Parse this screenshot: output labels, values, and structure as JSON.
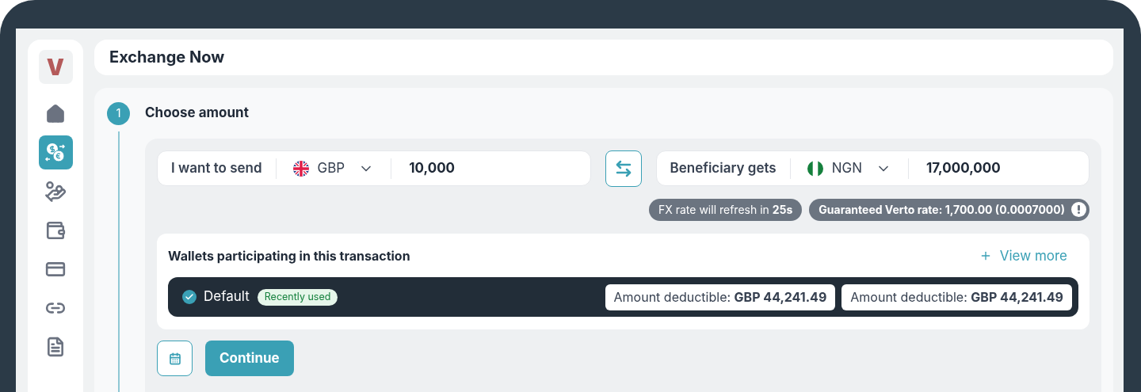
{
  "logo": {
    "letter": "V"
  },
  "sidebar": {
    "items": [
      {
        "selected": false
      },
      {
        "selected": true
      },
      {
        "selected": false
      },
      {
        "selected": false
      },
      {
        "selected": false
      },
      {
        "selected": false
      },
      {
        "selected": false
      }
    ]
  },
  "header": {
    "title": "Exchange Now"
  },
  "step": {
    "number": "1",
    "title": "Choose amount"
  },
  "send": {
    "label": "I want to send",
    "currency": "GBP",
    "amount": "10,000"
  },
  "receive": {
    "label": "Beneficiary gets",
    "currency": "NGN",
    "amount": "17,000,000"
  },
  "refresh_note": "FX rate will refresh in **25s**",
  "rate_note": "Guaranteed Verto rate: 1,700.00 (0.0007000)",
  "wallets": {
    "title": "Wallets participating in this transaction",
    "view_more": "View more",
    "items": [
      {
        "name": "Default",
        "checked": true,
        "tag": "Recently used",
        "amounts": [
          "Amount deductible: **GBP 44,241.49**",
          "Amount deductible: **GBP 44,241.49**"
        ]
      }
    ]
  },
  "actions": {
    "continue": "Continue"
  }
}
